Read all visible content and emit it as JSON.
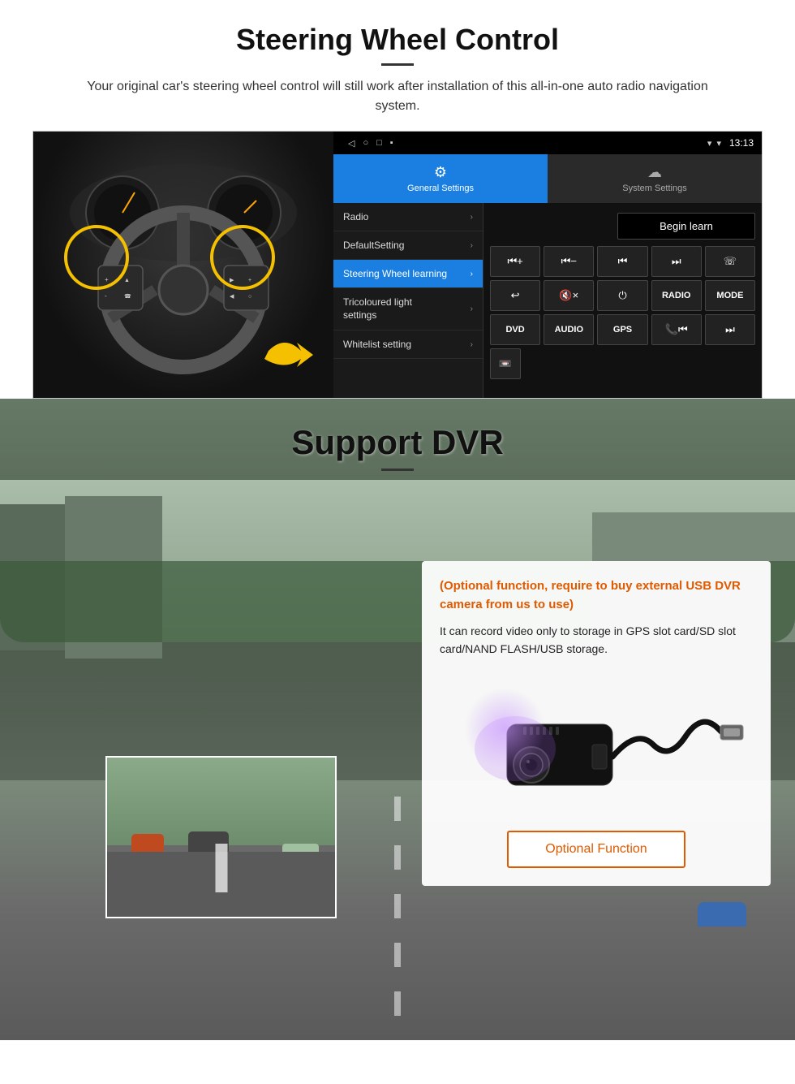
{
  "steering": {
    "title": "Steering Wheel Control",
    "subtitle": "Your original car's steering wheel control will still work after installation of this all-in-one auto radio navigation system.",
    "statusbar": {
      "time": "13:13",
      "signal_icon": "▼",
      "wifi_icon": "▾",
      "battery_icon": "▪"
    },
    "tabs": {
      "general": {
        "icon": "⚙",
        "label": "General Settings"
      },
      "system": {
        "icon": "☁",
        "label": "System Settings"
      }
    },
    "menu": [
      {
        "label": "Radio",
        "active": false
      },
      {
        "label": "DefaultSetting",
        "active": false
      },
      {
        "label": "Steering Wheel learning",
        "active": true
      },
      {
        "label": "Tricoloured light settings",
        "active": false
      },
      {
        "label": "Whitelist setting",
        "active": false
      }
    ],
    "begin_learn_label": "Begin learn",
    "buttons_row1": [
      "⏮+",
      "⏮-",
      "⏮",
      "⏭",
      "☏"
    ],
    "buttons_row2": [
      "↩",
      "🔇×",
      "⏻",
      "RADIO",
      "MODE"
    ],
    "buttons_row3": [
      "DVD",
      "AUDIO",
      "GPS",
      "📞⏮",
      "⏭"
    ],
    "buttons_row4": [
      "📼"
    ]
  },
  "dvr": {
    "title": "Support DVR",
    "optional_text": "(Optional function, require to buy external USB DVR camera from us to use)",
    "description": "It can record video only to storage in GPS slot card/SD slot card/NAND FLASH/USB storage.",
    "optional_function_label": "Optional Function"
  }
}
